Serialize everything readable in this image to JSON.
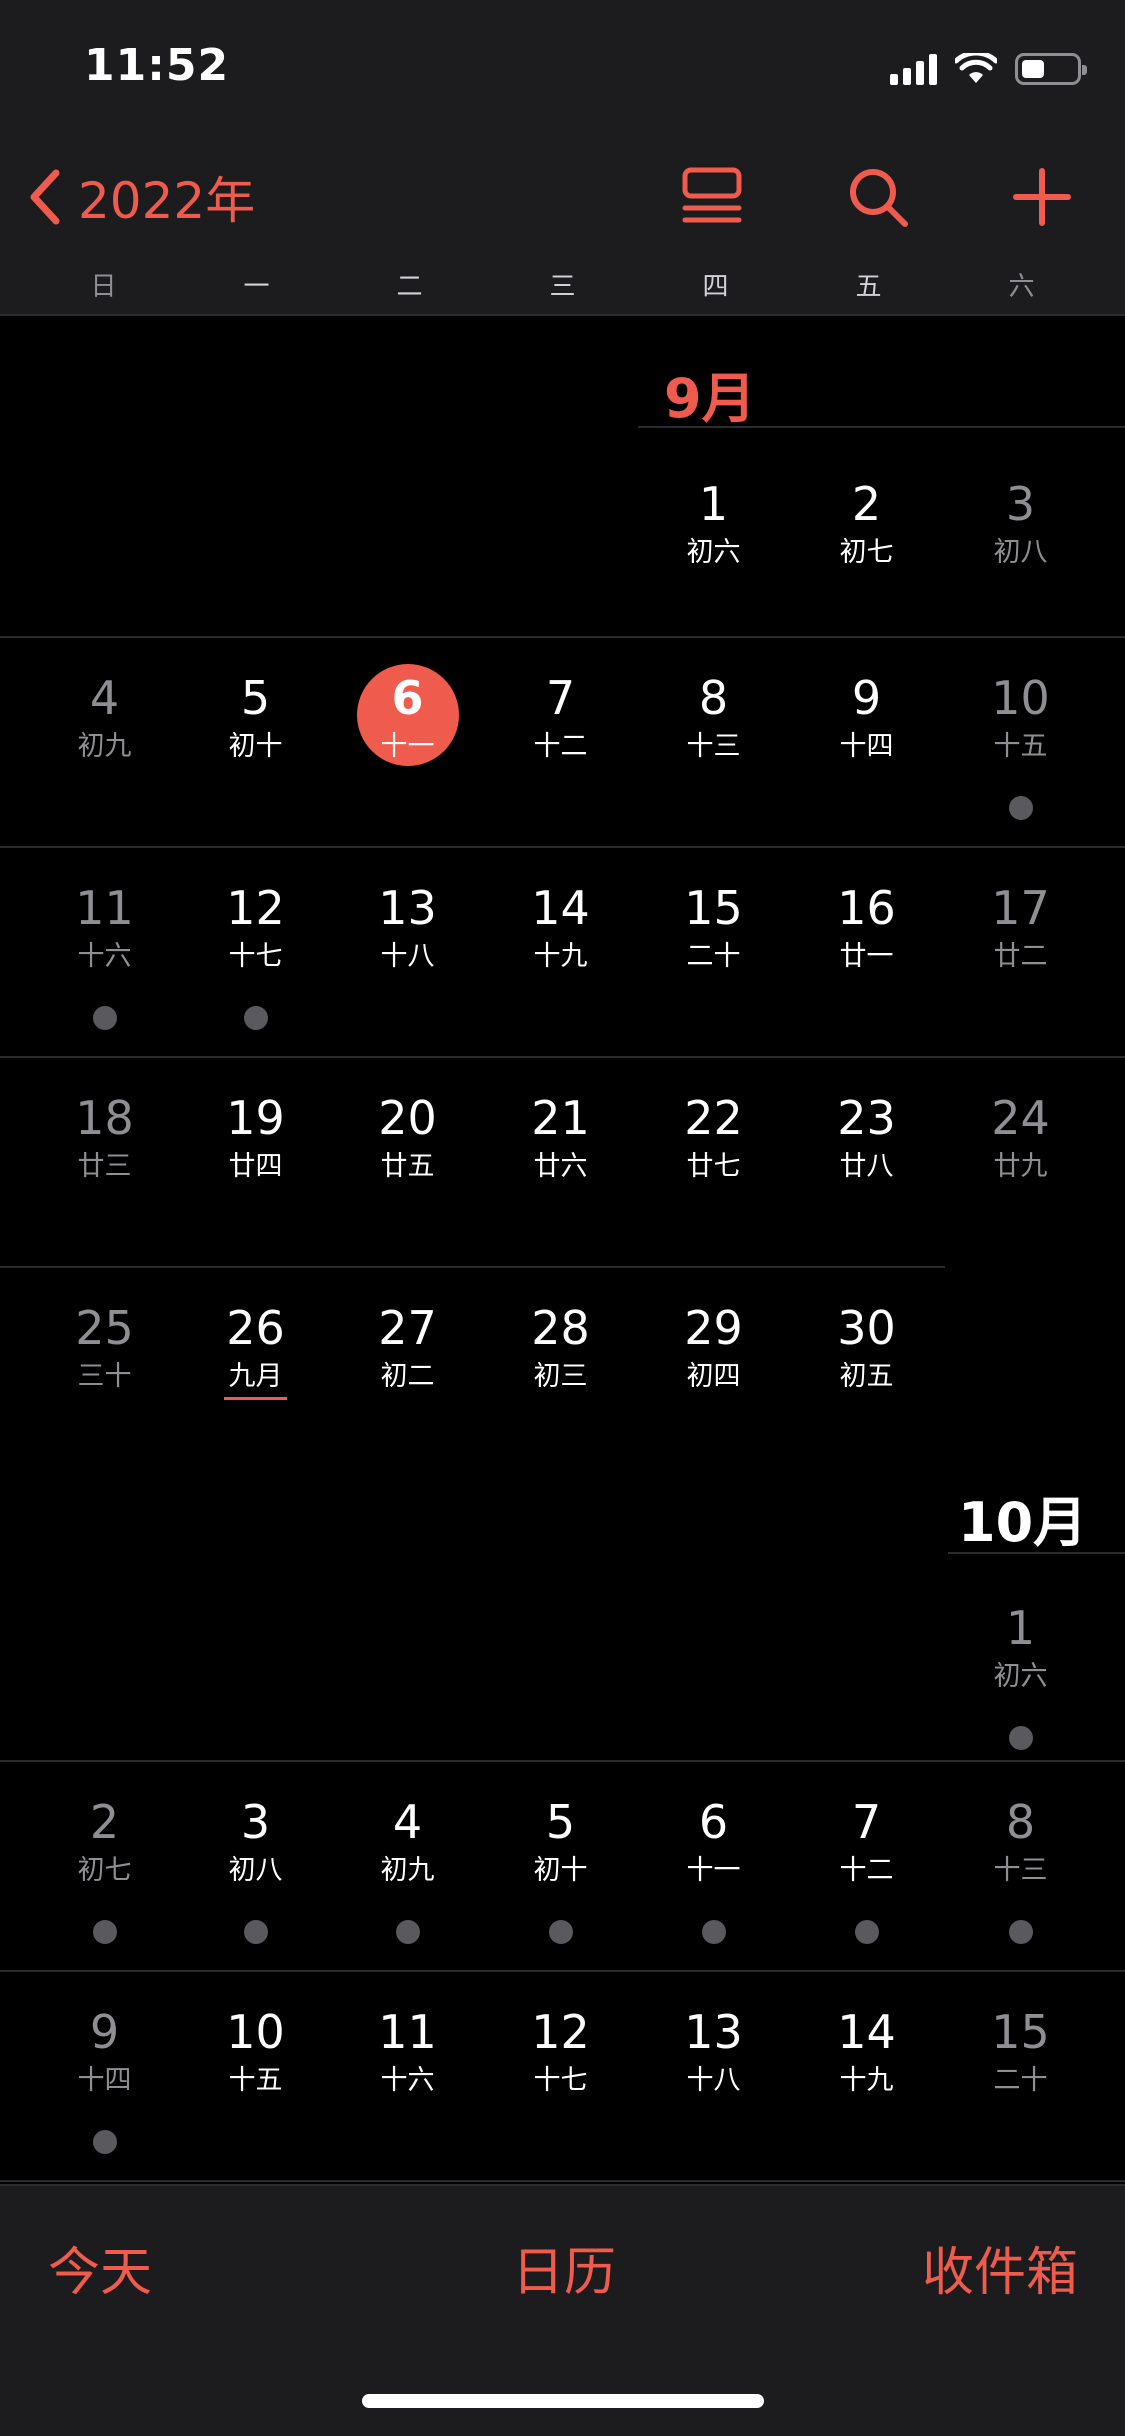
{
  "status": {
    "time": "11:52"
  },
  "header": {
    "back_label": "2022年",
    "icons": [
      "list-view-icon",
      "search-icon",
      "plus-icon"
    ]
  },
  "weekdays": [
    "日",
    "一",
    "二",
    "三",
    "四",
    "五",
    "六"
  ],
  "months": [
    {
      "label": "9月",
      "days": [
        {
          "d": "1",
          "l": "初六"
        },
        {
          "d": "2",
          "l": "初七"
        },
        {
          "d": "3",
          "l": "初八"
        },
        {
          "d": "4",
          "l": "初九"
        },
        {
          "d": "5",
          "l": "初十"
        },
        {
          "d": "6",
          "l": "十一",
          "today": true
        },
        {
          "d": "7",
          "l": "十二"
        },
        {
          "d": "8",
          "l": "十三"
        },
        {
          "d": "9",
          "l": "十四"
        },
        {
          "d": "10",
          "l": "十五",
          "event": true
        },
        {
          "d": "11",
          "l": "十六",
          "event": true
        },
        {
          "d": "12",
          "l": "十七",
          "event": true
        },
        {
          "d": "13",
          "l": "十八"
        },
        {
          "d": "14",
          "l": "十九"
        },
        {
          "d": "15",
          "l": "二十"
        },
        {
          "d": "16",
          "l": "廿一"
        },
        {
          "d": "17",
          "l": "廿二"
        },
        {
          "d": "18",
          "l": "廿三"
        },
        {
          "d": "19",
          "l": "廿四"
        },
        {
          "d": "20",
          "l": "廿五"
        },
        {
          "d": "21",
          "l": "廿六"
        },
        {
          "d": "22",
          "l": "廿七"
        },
        {
          "d": "23",
          "l": "廿八"
        },
        {
          "d": "24",
          "l": "廿九"
        },
        {
          "d": "25",
          "l": "三十"
        },
        {
          "d": "26",
          "l": "九月",
          "lunar_month_start": true
        },
        {
          "d": "27",
          "l": "初二"
        },
        {
          "d": "28",
          "l": "初三"
        },
        {
          "d": "29",
          "l": "初四"
        },
        {
          "d": "30",
          "l": "初五"
        }
      ]
    },
    {
      "label": "10月",
      "days": [
        {
          "d": "1",
          "l": "初六",
          "event": true
        },
        {
          "d": "2",
          "l": "初七",
          "event": true
        },
        {
          "d": "3",
          "l": "初八",
          "event": true
        },
        {
          "d": "4",
          "l": "初九",
          "event": true
        },
        {
          "d": "5",
          "l": "初十",
          "event": true
        },
        {
          "d": "6",
          "l": "十一",
          "event": true
        },
        {
          "d": "7",
          "l": "十二",
          "event": true
        },
        {
          "d": "8",
          "l": "十三",
          "event": true
        },
        {
          "d": "9",
          "l": "十四",
          "event": true
        },
        {
          "d": "10",
          "l": "十五"
        },
        {
          "d": "11",
          "l": "十六"
        },
        {
          "d": "12",
          "l": "十七"
        },
        {
          "d": "13",
          "l": "十八"
        },
        {
          "d": "14",
          "l": "十九"
        },
        {
          "d": "15",
          "l": "二十"
        }
      ]
    }
  ],
  "tabbar": {
    "today": "今天",
    "calendars": "日历",
    "inbox": "收件箱"
  },
  "colors": {
    "accent": "#ef5b4c",
    "background": "#000000",
    "bar": "#1c1c1e"
  }
}
